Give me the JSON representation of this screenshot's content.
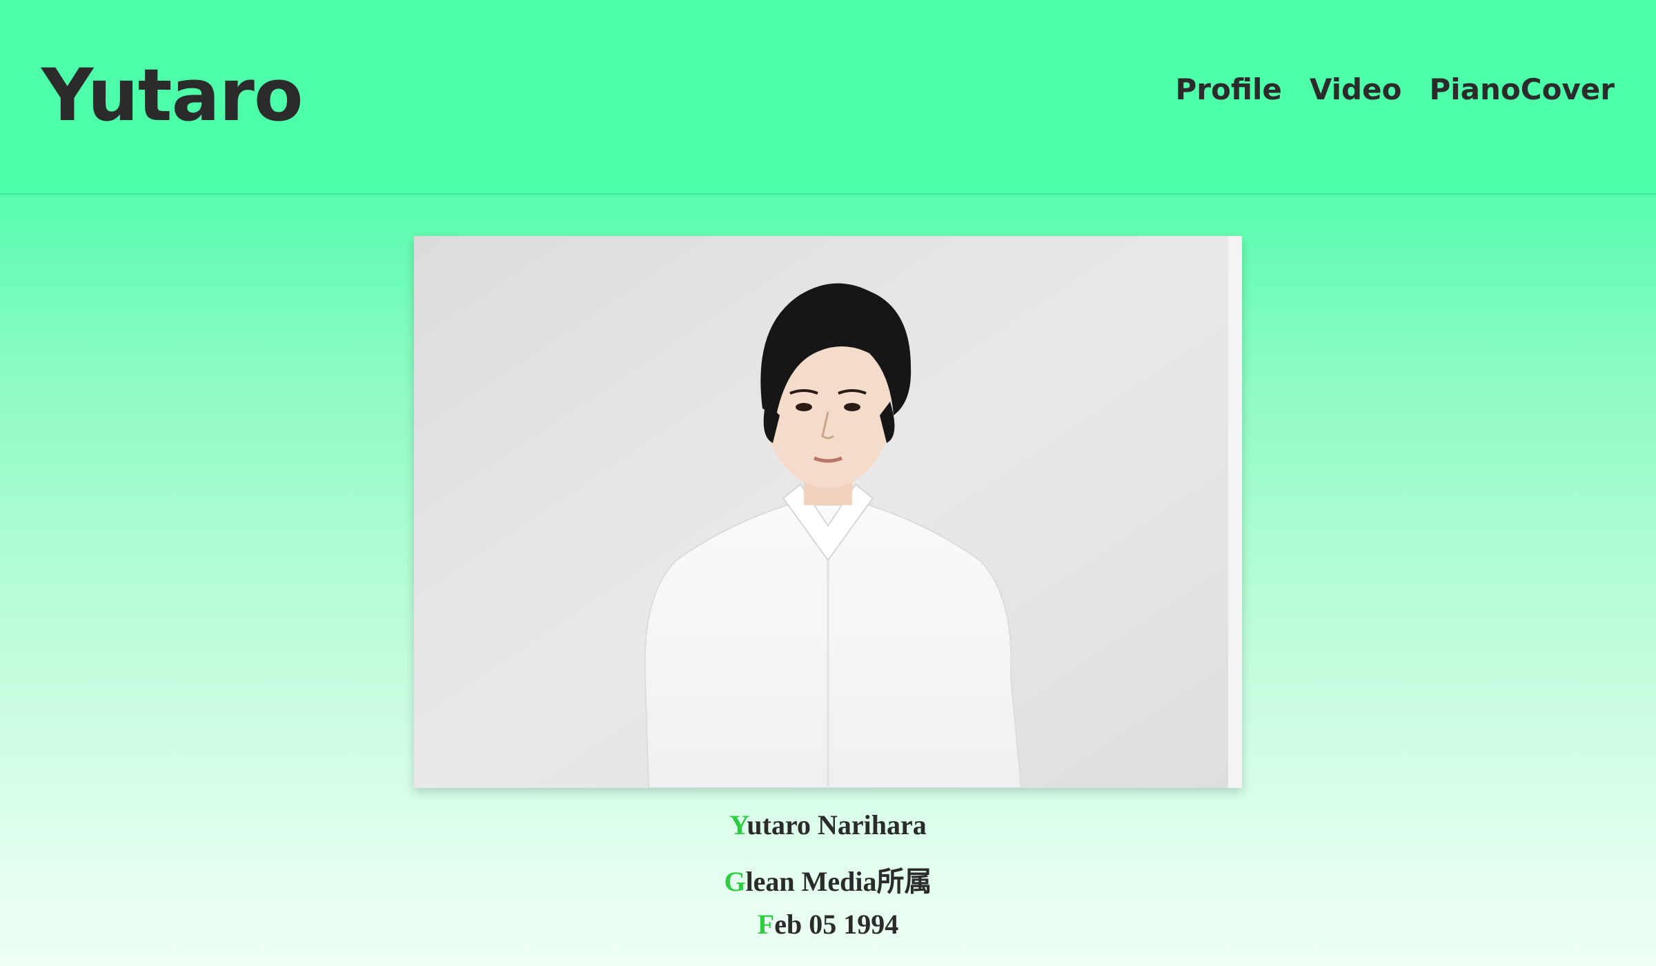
{
  "header": {
    "site_title": "Yutaro",
    "nav": [
      {
        "label": "Profile"
      },
      {
        "label": "Video"
      },
      {
        "label": "PianoCover"
      }
    ]
  },
  "profile": {
    "photo_alt": "portrait-photo",
    "lines": [
      {
        "initial": "Y",
        "rest": "utaro Narihara"
      },
      {
        "initial": "G",
        "rest": "lean Media所属"
      },
      {
        "initial": "F",
        "rest": "eb 05 1994"
      }
    ]
  },
  "colors": {
    "header_bg": "#4cffa8",
    "text": "#2b2b2b",
    "accent": "#2ecc40"
  }
}
